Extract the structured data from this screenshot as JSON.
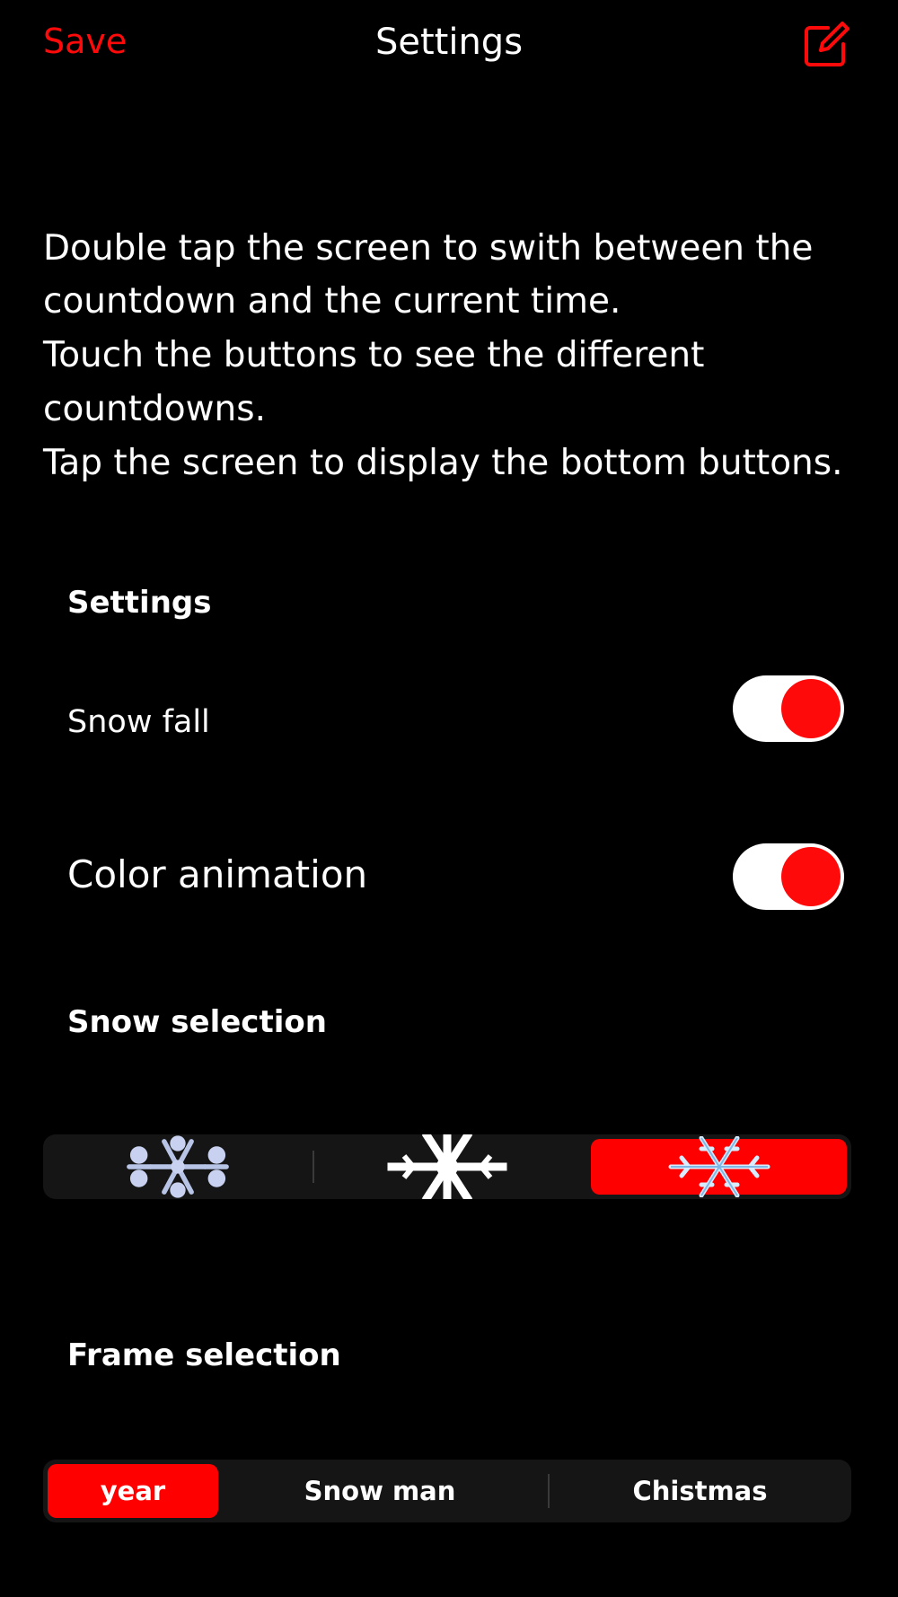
{
  "header": {
    "save_label": "Save",
    "title": "Settings",
    "edit_icon": "compose-icon"
  },
  "instructions": {
    "line1": "Double tap the screen to swith between the",
    "line2": "countdown and the current time.",
    "line3": "Touch the buttons to see the different",
    "line4": "countdowns.",
    "line5": "Tap the screen to display the bottom buttons."
  },
  "settings": {
    "heading": "Settings",
    "snow_fall": {
      "label": "Snow fall",
      "enabled": true
    },
    "color_animation": {
      "label": "Color animation",
      "enabled": true
    }
  },
  "snow_selection": {
    "heading": "Snow selection",
    "options": [
      "snowflake-ornate-icon",
      "snowflake-bold-icon",
      "snowflake-crystal-icon"
    ],
    "selected_index": 2
  },
  "frame_selection": {
    "heading": "Frame selection",
    "options": [
      "year",
      "Snow man",
      "Chistmas"
    ],
    "selected_index": 0
  },
  "colors": {
    "accent": "#ff0a0a",
    "background": "#000000",
    "segment_bg": "#151515"
  }
}
